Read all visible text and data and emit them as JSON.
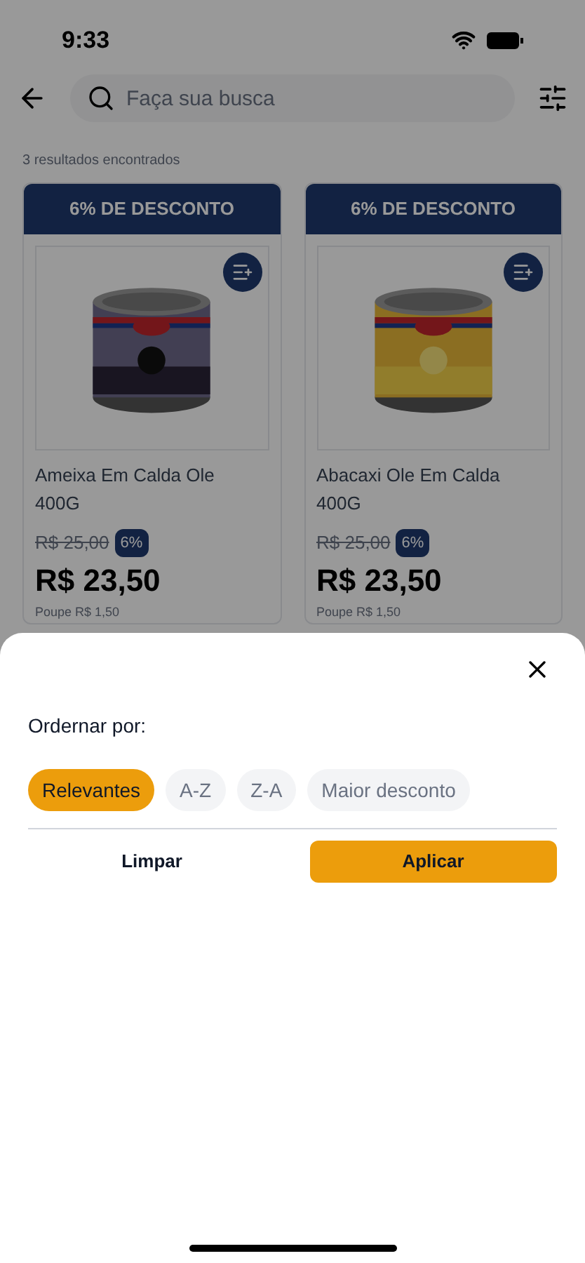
{
  "status_bar": {
    "time": "9:33"
  },
  "search": {
    "placeholder": "Faça sua busca"
  },
  "results_count": "3 resultados encontrados",
  "products": [
    {
      "banner": "6% DE DESCONTO",
      "name": "Ameixa Em Calda Ole 400G",
      "old_price": "R$ 25,00",
      "discount": "6%",
      "price": "R$ 23,50",
      "savings": "Poupe R$ 1,50"
    },
    {
      "banner": "6% DE DESCONTO",
      "name": "Abacaxi Ole Em Calda 400G",
      "old_price": "R$ 25,00",
      "discount": "6%",
      "price": "R$ 23,50",
      "savings": "Poupe R$ 1,50"
    }
  ],
  "sort_sheet": {
    "title": "Ordernar por:",
    "options": [
      {
        "label": "Relevantes",
        "selected": true
      },
      {
        "label": "A-Z",
        "selected": false
      },
      {
        "label": "Z-A",
        "selected": false
      },
      {
        "label": "Maior desconto",
        "selected": false
      }
    ],
    "clear_button": "Limpar",
    "apply_button": "Aplicar"
  }
}
